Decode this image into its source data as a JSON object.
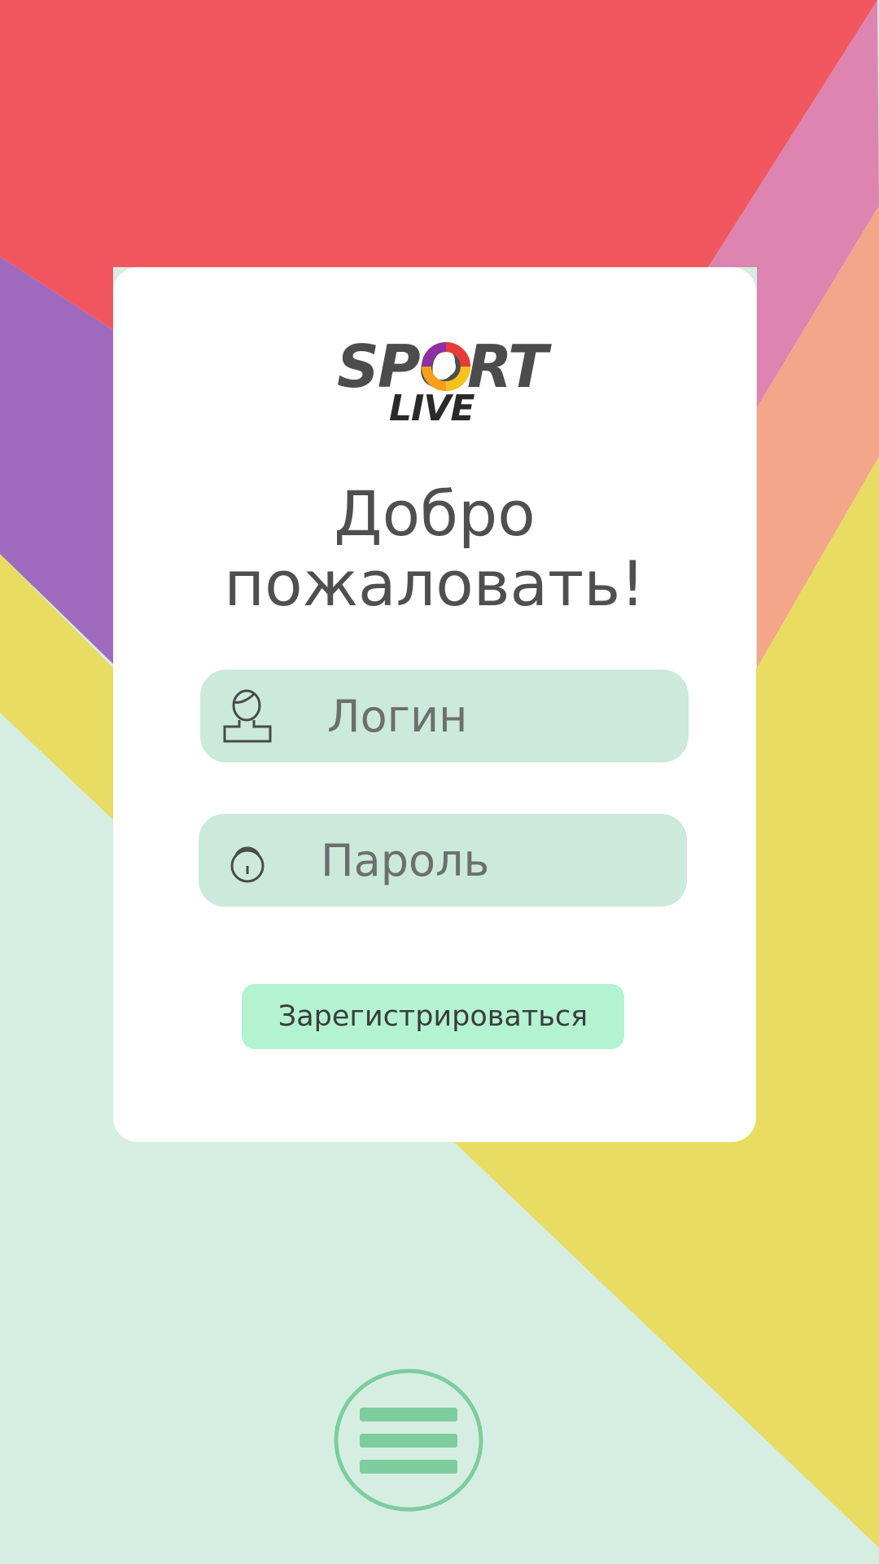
{
  "colors": {
    "red": "#f25760",
    "pink": "#dd85b0",
    "peach": "#f3a68a",
    "purple": "#a06bbf",
    "yellow": "#e8dc62",
    "mint": "#d6eee2",
    "card": "#ffffff",
    "field": "#cbeadb",
    "button": "#b3f3d2",
    "menu_accent": "#7dcd9e"
  },
  "logo": {
    "word_top": "SPORT",
    "word_bottom": "LIVE"
  },
  "welcome": {
    "title": "Добро\nпожаловать!"
  },
  "login": {
    "placeholder": "Логин",
    "icon": "user-icon"
  },
  "password": {
    "placeholder": "Пароль",
    "icon": "lock-icon"
  },
  "register": {
    "label": "Зарегистрироваться"
  },
  "menu": {
    "icon": "hamburger-menu-icon"
  }
}
